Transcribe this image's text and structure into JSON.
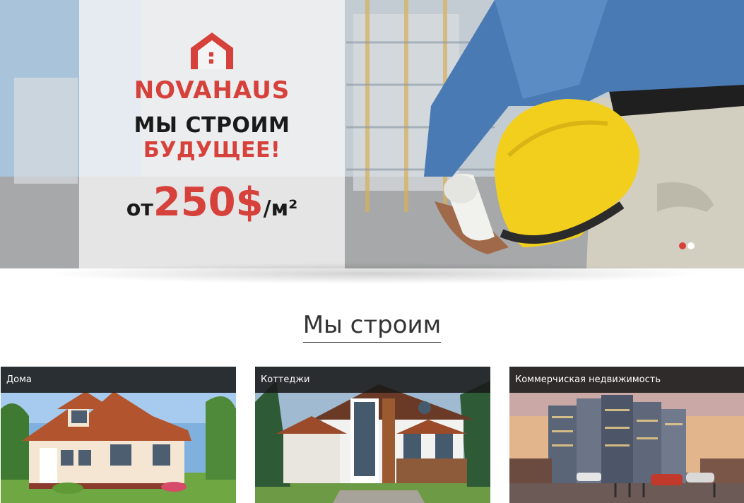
{
  "hero": {
    "brand": "NOVAHAUS",
    "headline_line1": "МЫ СТРОИМ",
    "headline_line2": "БУДУЩЕЕ!",
    "price_prefix": "от",
    "price_value": "250$",
    "price_unit": "/м²",
    "slides_total": 2,
    "active_slide": 1
  },
  "section": {
    "title": "Мы строим"
  },
  "cards": [
    {
      "label": "Дома"
    },
    {
      "label": "Коттеджи"
    },
    {
      "label": "Коммерчиская недвижимость"
    }
  ],
  "colors": {
    "brand_red": "#d6413b",
    "dark_text": "#1a1a1a",
    "helmet_yellow": "#f2cf1d",
    "shirt_blue": "#3f6fa8"
  },
  "icons": {
    "logo": "house-logo-icon",
    "slider": "slider-dot"
  }
}
